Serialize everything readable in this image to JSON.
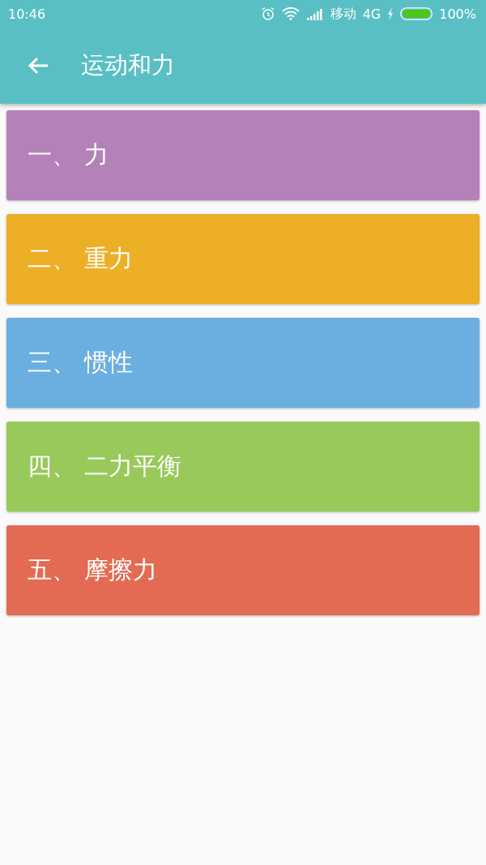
{
  "status_bar": {
    "time": "10:46",
    "carrier": "移动",
    "network": "4G",
    "battery": "100%"
  },
  "app_bar": {
    "title": "运动和力"
  },
  "items": [
    {
      "label": "一、 力",
      "color": "#b482b8"
    },
    {
      "label": "二、 重力",
      "color": "#edaf25"
    },
    {
      "label": "三、 惯性",
      "color": "#6aafe0"
    },
    {
      "label": "四、 二力平衡",
      "color": "#98c95a"
    },
    {
      "label": "五、 摩擦力",
      "color": "#e46b53"
    }
  ]
}
